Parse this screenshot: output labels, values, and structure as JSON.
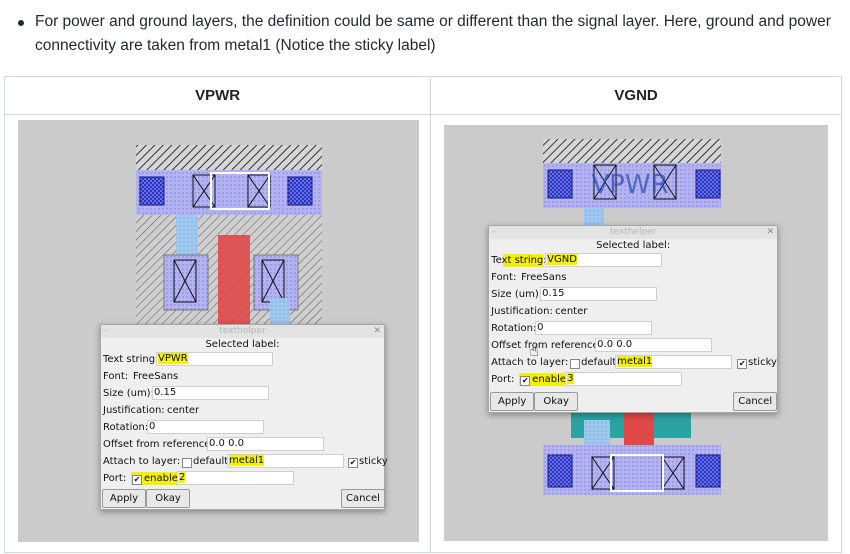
{
  "bullet": {
    "text": "For power and ground layers, the definition could be same or different than the signal layer. Here, ground and power connectivity are taken from metal1 (Notice the sticky label)"
  },
  "table": {
    "headers": [
      "VPWR",
      "VGND"
    ]
  },
  "left_dialog": {
    "title": "texthelper",
    "header": "Selected label:",
    "text_string_label": "Text string:",
    "text_string_value": "VPWR",
    "font_label": "Font:",
    "font_value": "FreeSans",
    "size_label": "Size (um):",
    "size_value": "0.15",
    "justification_label": "Justification:",
    "justification_value": "center",
    "rotation_label": "Rotation:",
    "rotation_value": "0",
    "offset_label": "Offset from reference:",
    "offset_value": "0.0 0.0",
    "attach_label": "Attach to layer:",
    "default_label": "default",
    "default_checked": false,
    "layer_value": "metal1",
    "sticky_label": "sticky",
    "sticky_checked": true,
    "port_label": "Port:",
    "enable_label": "enable",
    "enable_checked": true,
    "port_value": "2",
    "apply_label": "Apply",
    "okay_label": "Okay",
    "cancel_label": "Cancel"
  },
  "right_dialog": {
    "title": "texthelper",
    "header": "Selected label:",
    "text_string_label": "Text string:",
    "text_string_value": "VGND",
    "font_label": "Font:",
    "font_value": "FreeSans",
    "size_label": "Size (um):",
    "size_value": "0.15",
    "justification_label": "Justification:",
    "justification_value": "center",
    "rotation_label": "Rotation:",
    "rotation_value": "0",
    "offset_label": "Offset from reference:",
    "offset_value": "0.0 0.0",
    "attach_label": "Attach to layer:",
    "default_label": "default",
    "default_checked": false,
    "layer_value": "metal1",
    "sticky_label": "sticky",
    "sticky_checked": true,
    "port_label": "Port:",
    "enable_label": "enable",
    "enable_checked": true,
    "port_value": "3",
    "apply_label": "Apply",
    "okay_label": "Okay",
    "cancel_label": "Cancel"
  },
  "right_layout": {
    "label_text": "VPWR"
  },
  "icons": {
    "check_glyph": "✔",
    "close_glyph": "✕",
    "cursor_glyph": "☝"
  },
  "colors": {
    "metal1": "#a9a9f0",
    "poly": "#e04848",
    "highlight": "#f4f000",
    "canvas": "#cbcbcb"
  }
}
